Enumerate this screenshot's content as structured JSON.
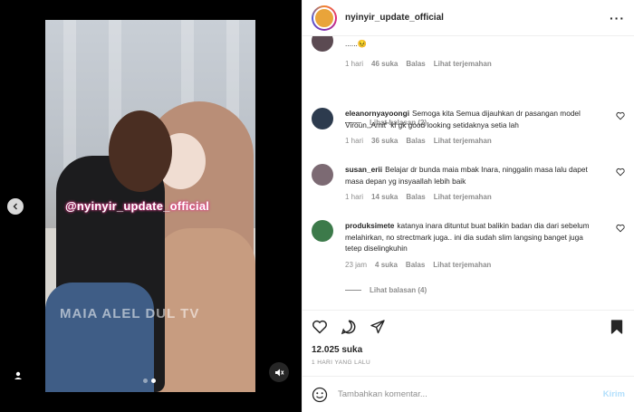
{
  "post": {
    "username": "nyinyir_update_official",
    "more_icon": "more-icon",
    "media": {
      "watermark": "@nyinyir_update_official",
      "watermark2": "MAIA ALEL DUL TV",
      "carousel_total": 2,
      "carousel_active": 1
    }
  },
  "comments": [
    {
      "username": "",
      "text": "......😣",
      "time": "1 hari",
      "likes": "46 suka",
      "reply": "Balas",
      "translate": "Lihat terjemahan",
      "view_replies": "Lihat balasan (2)",
      "avatar_color": "#5b4a52"
    },
    {
      "username": "eleanornyayoongi",
      "text": "Semoga kita Semua dijauhkan dr pasangan model Viroun,,Amit\" kl gk good looking setidaknya setia lah",
      "time": "1 hari",
      "likes": "36 suka",
      "reply": "Balas",
      "translate": "Lihat terjemahan",
      "avatar_color": "#2d3b4e"
    },
    {
      "username": "susan_erii",
      "text": "Belajar dr bunda maia mbak Inara, ninggalin masa lalu dapet masa depan yg insyaallah lebih baik",
      "time": "1 hari",
      "likes": "14 suka",
      "reply": "Balas",
      "translate": "Lihat terjemahan",
      "avatar_color": "#7c6a73"
    },
    {
      "username": "produksimete",
      "text": "katanya inara dituntut buat balikin badan dia dari sebelum melahirkan, no strectmark juga.. ini dia sudah slim langsing banget juga tetep diselingkuhin",
      "time": "23 jam",
      "likes": "4 suka",
      "reply": "Balas",
      "translate": "Lihat terjemahan",
      "view_replies": "Lihat balasan (4)",
      "avatar_color": "#3c7a4a"
    }
  ],
  "stats": {
    "likes": "12.025 suka",
    "time": "1 HARI YANG LALU"
  },
  "composer": {
    "placeholder": "Tambahkan komentar...",
    "post_label": "Kirim"
  }
}
